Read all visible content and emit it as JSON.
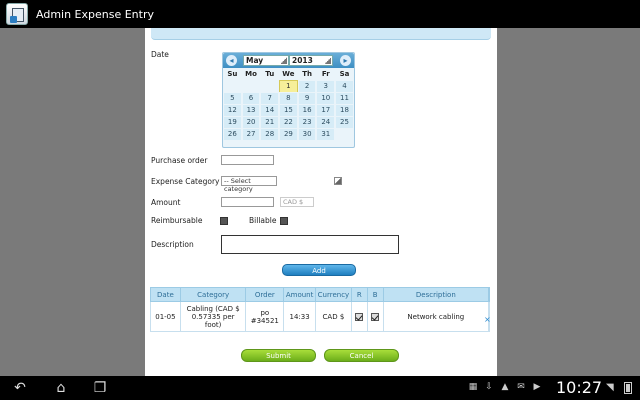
{
  "app": {
    "title": "Admin Expense Entry"
  },
  "form": {
    "date_label": "Date",
    "purchase_order_label": "Purchase order",
    "expense_category_label": "Expense Category",
    "expense_category_value": "-- Select category",
    "amount_label": "Amount",
    "currency_value": "CAD $",
    "reimbursable_label": "Reimbursable",
    "billable_label": "Billable",
    "description_label": "Description",
    "add_label": "Add"
  },
  "calendar": {
    "month": "May",
    "year": "2013",
    "weekdays": [
      "Su",
      "Mo",
      "Tu",
      "We",
      "Th",
      "Fr",
      "Sa"
    ],
    "selected_day": "1",
    "weeks": [
      [
        "",
        "",
        "",
        "1",
        "2",
        "3",
        "4"
      ],
      [
        "5",
        "6",
        "7",
        "8",
        "9",
        "10",
        "11"
      ],
      [
        "12",
        "13",
        "14",
        "15",
        "16",
        "17",
        "18"
      ],
      [
        "19",
        "20",
        "21",
        "22",
        "23",
        "24",
        "25"
      ],
      [
        "26",
        "27",
        "28",
        "29",
        "30",
        "31",
        ""
      ]
    ]
  },
  "table": {
    "headers": [
      "Date",
      "Category",
      "Order",
      "Amount",
      "Currency",
      "R",
      "B",
      "Description"
    ],
    "rows": [
      {
        "date": "01-05",
        "category": "Cabling (CAD $ 0.57335 per foot)",
        "order": "po #34521",
        "amount": "14:33",
        "currency": "CAD $",
        "reimbursable": true,
        "billable": true,
        "description": "Network cabling"
      }
    ]
  },
  "actions": {
    "submit_label": "Submit",
    "cancel_label": "Cancel"
  },
  "status_bar": {
    "time": "10:27"
  }
}
